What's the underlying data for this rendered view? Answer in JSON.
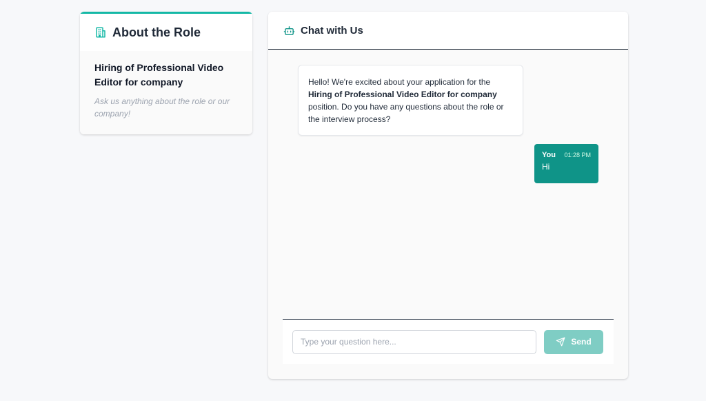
{
  "role_panel": {
    "heading": "About the Role",
    "heading_icon": "building-icon",
    "job_title": "Hiring of Professional Video Editor for company",
    "hint": "Ask us anything about the role or our company!"
  },
  "chat": {
    "heading": "Chat with Us",
    "heading_icon": "robot-icon",
    "bot_message": {
      "intro": "Hello! We're excited about your application for the ",
      "position": "Hiring of Professional Video Editor for company",
      "outro": " position. Do you have any questions about the role or the interview process?"
    },
    "user_message": {
      "sender": "You",
      "time": "01:28 PM",
      "text": "Hi"
    },
    "input": {
      "placeholder": "Type your question here...",
      "value": ""
    },
    "send_label": "Send",
    "send_icon": "paper-plane-icon"
  },
  "colors": {
    "accent": "#14b8a6",
    "user_bubble": "#0f9488",
    "send_button": "#7fcdc4"
  }
}
